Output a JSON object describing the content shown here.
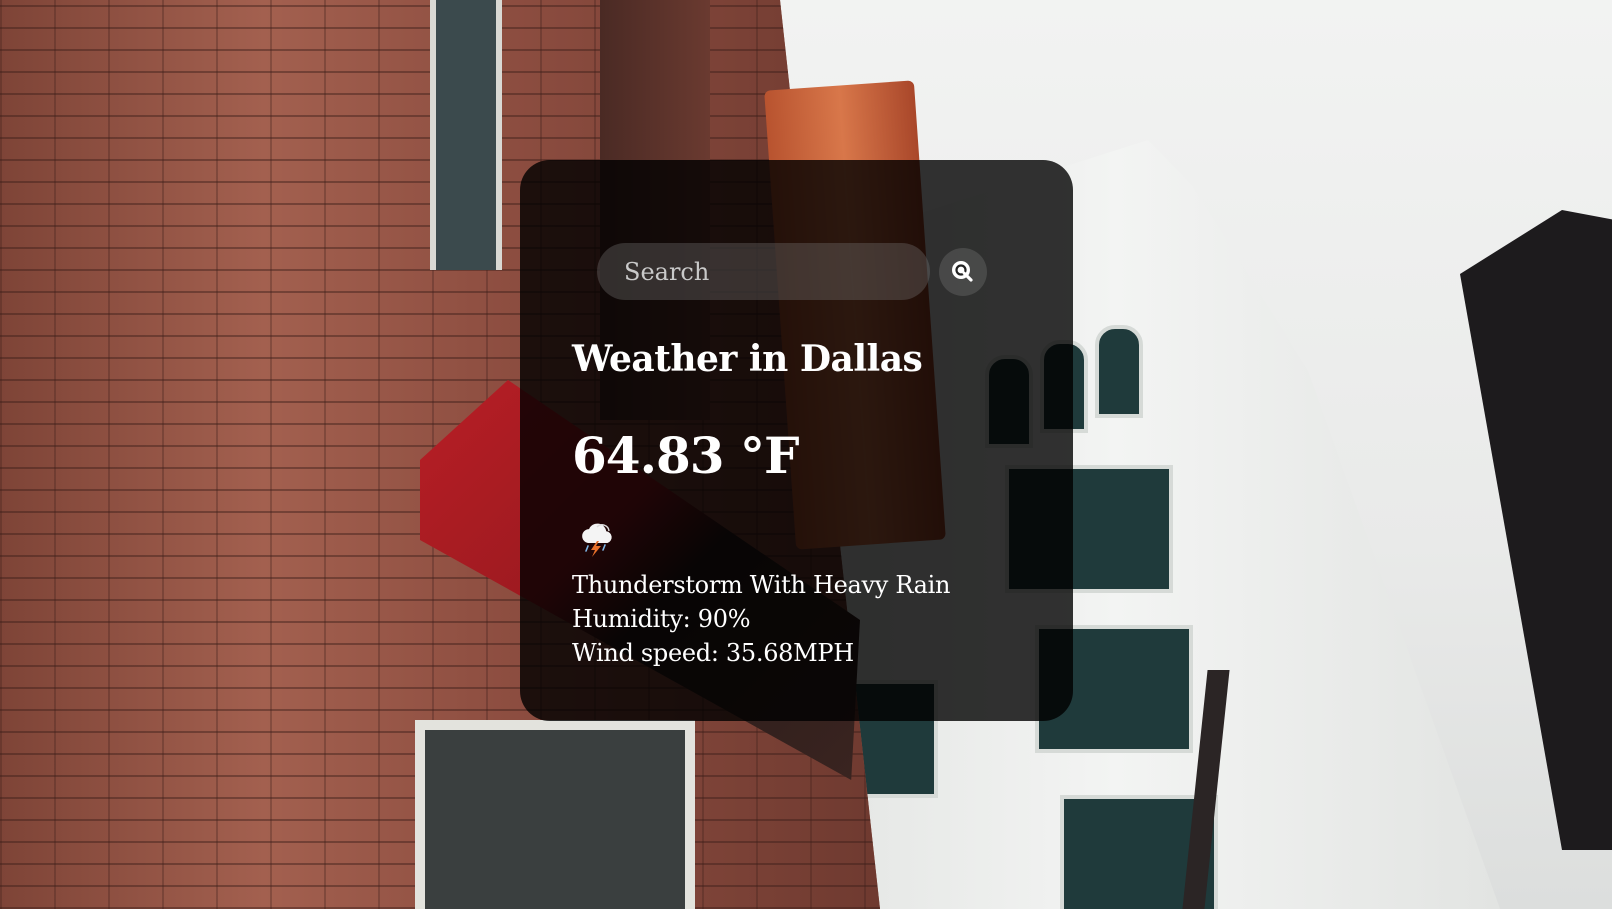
{
  "search": {
    "placeholder": "Search",
    "value": "",
    "button_icon": "search-icon"
  },
  "weather": {
    "title": "Weather in Dallas",
    "temperature": "64.83 °F",
    "icon": "thunderstorm-cloud-icon",
    "description": "Thunderstorm With Heavy Rain",
    "humidity": "Humidity: 90%",
    "wind": "Wind speed: 35.68MPH"
  },
  "colors": {
    "card_background": "#000000cc",
    "text": "#ffffff",
    "input_background": "#7c7c7c55"
  }
}
